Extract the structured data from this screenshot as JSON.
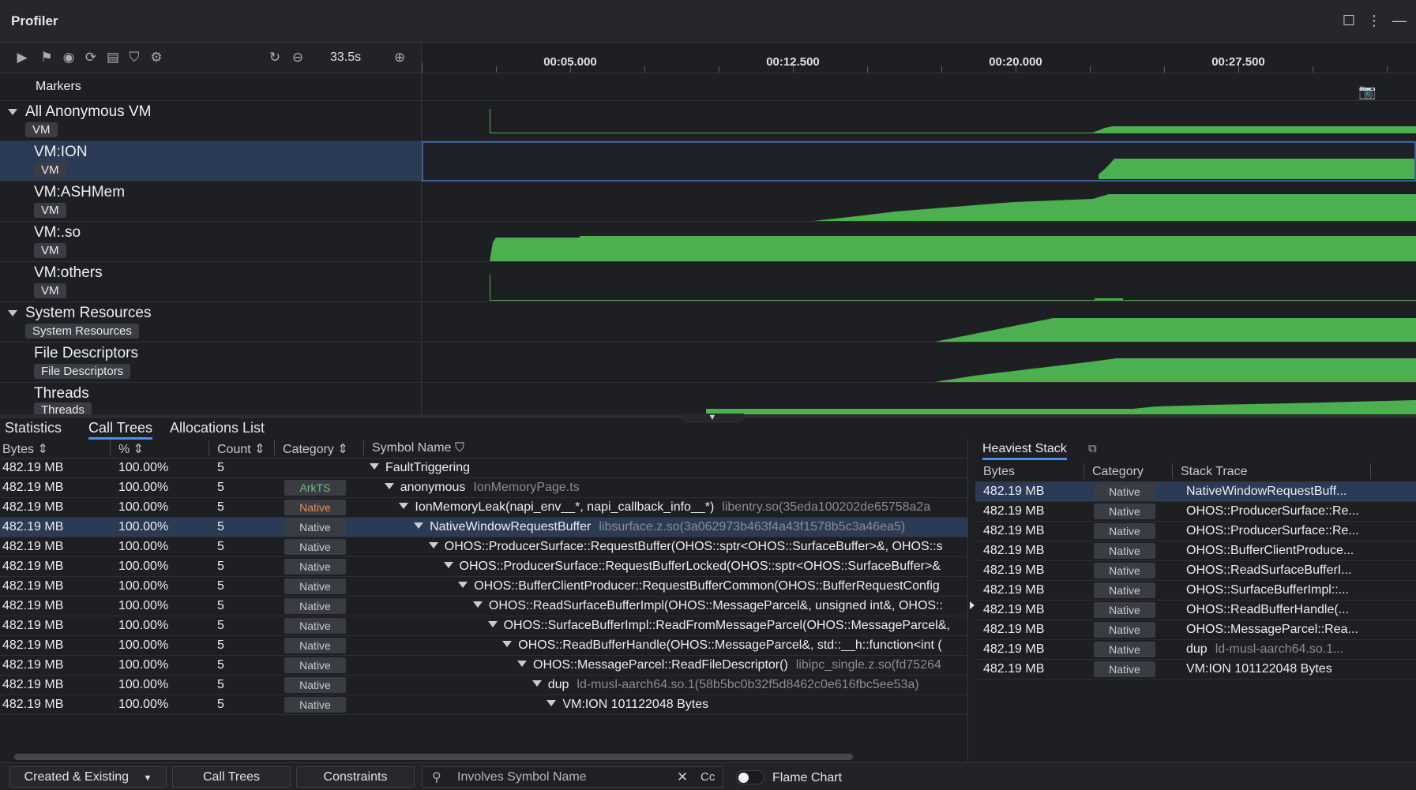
{
  "app": {
    "title": "Profiler"
  },
  "toolbar": {
    "duration": "33.5s",
    "icons": [
      "play-icon",
      "flag-icon",
      "record-icon",
      "capture-icon",
      "trash-icon",
      "filter-icon",
      "settings-icon",
      "reset-zoom-icon",
      "zoom-out-icon",
      "zoom-in-icon"
    ]
  },
  "ruler": {
    "ticks": [
      "00:05.000",
      "00:12.500",
      "00:20.000",
      "00:27.500"
    ]
  },
  "tracks": {
    "markers_label": "Markers",
    "all_anon_vm": {
      "title": "All Anonymous VM",
      "badge": "VM"
    },
    "vm_ion": {
      "title": "VM:ION",
      "badge": "VM"
    },
    "vm_ashmem": {
      "title": "VM:ASHMem",
      "badge": "VM"
    },
    "vm_so": {
      "title": "VM:.so",
      "badge": "VM"
    },
    "vm_others": {
      "title": "VM:others",
      "badge": "VM"
    },
    "system_resources": {
      "title": "System Resources",
      "badge": "System Resources"
    },
    "file_descriptors": {
      "title": "File Descriptors",
      "badge": "File Descriptors"
    },
    "threads": {
      "title": "Threads",
      "badge": "Threads"
    }
  },
  "bottom_tabs": [
    "Statistics",
    "Call Trees",
    "Allocations List"
  ],
  "call_tree": {
    "columns": [
      "Bytes",
      "%",
      "Count",
      "Category",
      "Symbol Name"
    ],
    "rows": [
      {
        "bytes": "482.19 MB",
        "pct": "100.00%",
        "count": "5",
        "category": "",
        "symbol": "FaultTriggering",
        "lib": "",
        "depth": 0
      },
      {
        "bytes": "482.19 MB",
        "pct": "100.00%",
        "count": "5",
        "category": "ArkTS",
        "symbol": "anonymous",
        "lib": "IonMemoryPage.ts",
        "depth": 1
      },
      {
        "bytes": "482.19 MB",
        "pct": "100.00%",
        "count": "5",
        "category": "Native",
        "symbol": "IonMemoryLeak(napi_env__*, napi_callback_info__*)",
        "lib": "libentry.so(35eda100202de65758a2a",
        "depth": 2
      },
      {
        "bytes": "482.19 MB",
        "pct": "100.00%",
        "count": "5",
        "category": "Native",
        "symbol": "NativeWindowRequestBuffer",
        "lib": "libsurface.z.so(3a062973b463f4a43f1578b5c3a46ea5)",
        "depth": 3
      },
      {
        "bytes": "482.19 MB",
        "pct": "100.00%",
        "count": "5",
        "category": "Native",
        "symbol": "OHOS::ProducerSurface::RequestBuffer(OHOS::sptr<OHOS::SurfaceBuffer>&, OHOS::s",
        "lib": "",
        "depth": 4
      },
      {
        "bytes": "482.19 MB",
        "pct": "100.00%",
        "count": "5",
        "category": "Native",
        "symbol": "OHOS::ProducerSurface::RequestBufferLocked(OHOS::sptr<OHOS::SurfaceBuffer>&",
        "lib": "",
        "depth": 5
      },
      {
        "bytes": "482.19 MB",
        "pct": "100.00%",
        "count": "5",
        "category": "Native",
        "symbol": "OHOS::BufferClientProducer::RequestBufferCommon(OHOS::BufferRequestConfig",
        "lib": "",
        "depth": 6
      },
      {
        "bytes": "482.19 MB",
        "pct": "100.00%",
        "count": "5",
        "category": "Native",
        "symbol": "OHOS::ReadSurfaceBufferImpl(OHOS::MessageParcel&, unsigned int&, OHOS::",
        "lib": "",
        "depth": 7
      },
      {
        "bytes": "482.19 MB",
        "pct": "100.00%",
        "count": "5",
        "category": "Native",
        "symbol": "OHOS::SurfaceBufferImpl::ReadFromMessageParcel(OHOS::MessageParcel&,",
        "lib": "",
        "depth": 8
      },
      {
        "bytes": "482.19 MB",
        "pct": "100.00%",
        "count": "5",
        "category": "Native",
        "symbol": "OHOS::ReadBufferHandle(OHOS::MessageParcel&, std::__h::function<int (",
        "lib": "",
        "depth": 9
      },
      {
        "bytes": "482.19 MB",
        "pct": "100.00%",
        "count": "5",
        "category": "Native",
        "symbol": "OHOS::MessageParcel::ReadFileDescriptor()",
        "lib": "libipc_single.z.so(fd75264",
        "depth": 10
      },
      {
        "bytes": "482.19 MB",
        "pct": "100.00%",
        "count": "5",
        "category": "Native",
        "symbol": "dup",
        "lib": "ld-musl-aarch64.so.1(58b5bc0b32f5d8462c0e616fbc5ee53a)",
        "depth": 11
      },
      {
        "bytes": "482.19 MB",
        "pct": "100.00%",
        "count": "5",
        "category": "Native",
        "symbol": "VM:ION 101122048 Bytes",
        "lib": "",
        "depth": 12
      }
    ]
  },
  "heaviest_stack": {
    "tab": "Heaviest Stack",
    "columns": [
      "Bytes",
      "Category",
      "Stack Trace"
    ],
    "rows": [
      {
        "bytes": "482.19 MB",
        "category": "Native",
        "trace": "NativeWindowRequestBuff...",
        "lib": ""
      },
      {
        "bytes": "482.19 MB",
        "category": "Native",
        "trace": "OHOS::ProducerSurface::Re...",
        "lib": ""
      },
      {
        "bytes": "482.19 MB",
        "category": "Native",
        "trace": "OHOS::ProducerSurface::Re...",
        "lib": ""
      },
      {
        "bytes": "482.19 MB",
        "category": "Native",
        "trace": "OHOS::BufferClientProduce...",
        "lib": ""
      },
      {
        "bytes": "482.19 MB",
        "category": "Native",
        "trace": "OHOS::ReadSurfaceBufferI...",
        "lib": ""
      },
      {
        "bytes": "482.19 MB",
        "category": "Native",
        "trace": "OHOS::SurfaceBufferImpl::...",
        "lib": ""
      },
      {
        "bytes": "482.19 MB",
        "category": "Native",
        "trace": "OHOS::ReadBufferHandle(...",
        "lib": ""
      },
      {
        "bytes": "482.19 MB",
        "category": "Native",
        "trace": "OHOS::MessageParcel::Rea...",
        "lib": ""
      },
      {
        "bytes": "482.19 MB",
        "category": "Native",
        "trace": "dup",
        "lib": "ld-musl-aarch64.so.1..."
      },
      {
        "bytes": "482.19 MB",
        "category": "Native",
        "trace": "VM:ION 101122048 Bytes",
        "lib": ""
      }
    ]
  },
  "statusbar": {
    "mode": "Created & Existing",
    "call_trees_btn": "Call Trees",
    "constraints_btn": "Constraints",
    "search_placeholder": "Involves Symbol Name",
    "case_label": "Cc",
    "flame_chart_label": "Flame Chart"
  },
  "colors": {
    "accent": "#4d8ef0",
    "track_fill": "#4caf50",
    "selection": "#2b3a55"
  }
}
